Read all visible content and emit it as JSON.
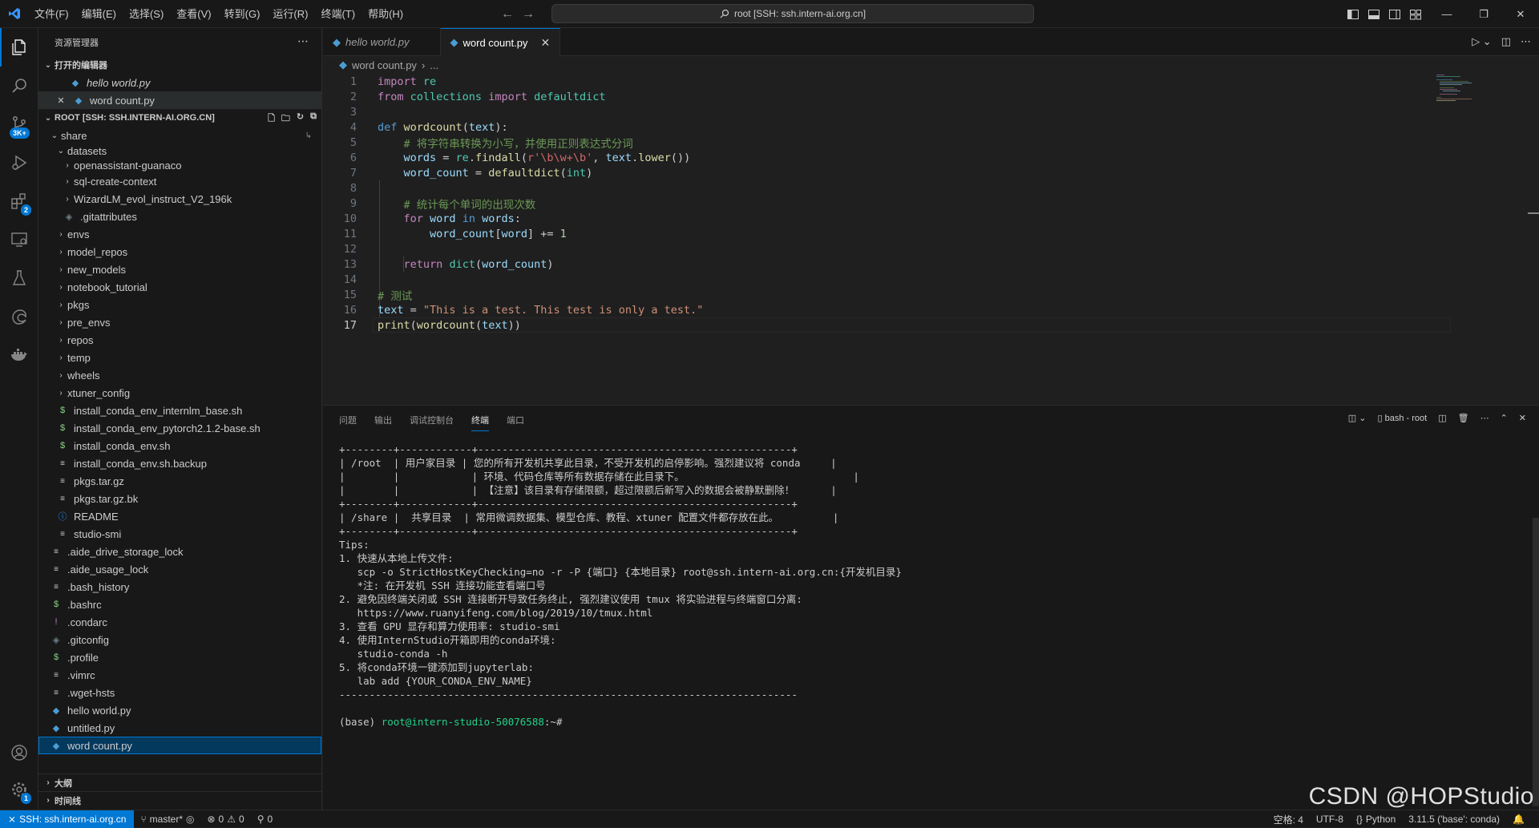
{
  "titlebar": {
    "menu": [
      "文件(F)",
      "编辑(E)",
      "选择(S)",
      "查看(V)",
      "转到(G)",
      "运行(R)",
      "终端(T)",
      "帮助(H)"
    ],
    "command_center": "root [SSH: ssh.intern-ai.org.cn]"
  },
  "activitybar": {
    "scm_badge": "3K+",
    "extensions_badge": "2",
    "settings_badge": "1"
  },
  "sidebar": {
    "title": "资源管理器",
    "open_editors_header": "打开的编辑器",
    "open_editors": [
      "hello world.py",
      "word count.py"
    ],
    "root_header": "ROOT [SSH: SSH.INTERN-AI.ORG.CN]",
    "tree": {
      "share": "share",
      "datasets": "datasets",
      "openassistant": "openassistant-guanaco",
      "sqlcreate": "sql-create-context",
      "wizard": "WizardLM_evol_instruct_V2_196k",
      "gitattributes": ".gitattributes",
      "envs": "envs",
      "model_repos": "model_repos",
      "new_models": "new_models",
      "notebook_tutorial": "notebook_tutorial",
      "pkgs": "pkgs",
      "pre_envs": "pre_envs",
      "repos": "repos",
      "temp": "temp",
      "wheels": "wheels",
      "xtuner_config": "xtuner_config",
      "install_internlm": "install_conda_env_internlm_base.sh",
      "install_pytorch": "install_conda_env_pytorch2.1.2-base.sh",
      "install_env": "install_conda_env.sh",
      "install_backup": "install_conda_env.sh.backup",
      "pkgs_tar": "pkgs.tar.gz",
      "pkgs_tar_bk": "pkgs.tar.gz.bk",
      "readme": "README",
      "studio_smi": "studio-smi",
      "aide_drive": ".aide_drive_storage_lock",
      "aide_usage": ".aide_usage_lock",
      "bash_history": ".bash_history",
      "bashrc": ".bashrc",
      "condarc": ".condarc",
      "gitconfig": ".gitconfig",
      "profile": ".profile",
      "vimrc": ".vimrc",
      "wget_hsts": ".wget-hsts",
      "hello_world": "hello world.py",
      "untitled": "untitled.py",
      "word_count": "word count.py"
    },
    "outline_header": "大纲",
    "timeline_header": "时间线"
  },
  "tabs": [
    {
      "label": "hello world.py"
    },
    {
      "label": "word count.py"
    }
  ],
  "breadcrumb": {
    "file": "word count.py",
    "more": "..."
  },
  "code": {
    "line_numbers": [
      "1",
      "2",
      "3",
      "4",
      "5",
      "6",
      "7",
      "8",
      "9",
      "10",
      "11",
      "12",
      "13",
      "14",
      "15",
      "16",
      "17"
    ],
    "comment1": "# 将字符串转换为小写，并使用正则表达式分词",
    "comment2": "# 统计每个单词的出现次数",
    "comment3": "# 测试",
    "test_string": "\"This is a test. This test is only a test.\"",
    "regex": "r'\\b\\w+\\b'"
  },
  "panel": {
    "tabs": [
      "问题",
      "输出",
      "调试控制台",
      "终端",
      "端口"
    ],
    "terminal_name": "bash - root",
    "terminal_lines": [
      "+--------+------------+----------------------------------------------------+",
      "| /root  | 用户家目录 | 您的所有开发机共享此目录，不受开发机的启停影响。强烈建议将 conda     |",
      "|        |            | 环境、代码仓库等所有数据存储在此目录下。                            |",
      "|        |            | 【注意】该目录有存储限额，超过限额后新写入的数据会被静默删除！      |",
      "+--------+------------+----------------------------------------------------+",
      "| /share |  共享目录  | 常用微调数据集、模型仓库、教程、xtuner 配置文件都存放在此。         |",
      "+--------+------------+----------------------------------------------------+",
      "Tips:",
      "",
      "1. 快速从本地上传文件:",
      "   scp -o StrictHostKeyChecking=no -r -P {端口} {本地目录} root@ssh.intern-ai.org.cn:{开发机目录}",
      "   *注: 在开发机 SSH 连接功能查看端口号",
      "",
      "2. 避免因终端关闭或 SSH 连接断开导致任务终止, 强烈建议使用 tmux 将实验进程与终端窗口分离:",
      "   https://www.ruanyifeng.com/blog/2019/10/tmux.html",
      "",
      "3. 查看 GPU 显存和算力使用率: studio-smi",
      "",
      "4. 使用InternStudio开箱即用的conda环境:",
      "   studio-conda -h",
      "",
      "5. 将conda环境一键添加到jupyterlab:",
      "   lab add {YOUR_CONDA_ENV_NAME}",
      "",
      "----------------------------------------------------------------------------"
    ],
    "prompt_env": "(base) ",
    "prompt_user": "root@intern-studio-50076588",
    "prompt_path": ":~#"
  },
  "statusbar": {
    "remote": "SSH: ssh.intern-ai.org.cn",
    "branch": "master*",
    "errors": "0",
    "warnings": "0",
    "ports": "0",
    "spaces": "空格: 4",
    "encoding": "UTF-8",
    "language": "Python",
    "interpreter": "3.11.5 ('base': conda)"
  },
  "watermark": "CSDN @HOPStudio"
}
